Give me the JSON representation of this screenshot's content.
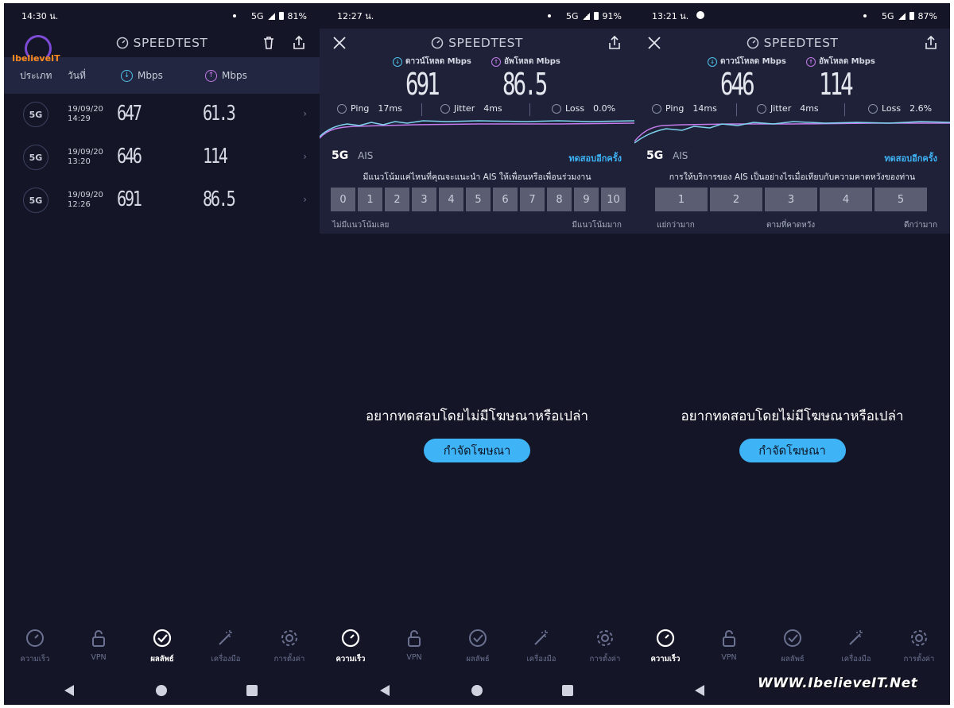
{
  "colors": {
    "bg": "#141526",
    "card": "#1e2138",
    "download": "#4fc3e8",
    "upload": "#c27be8",
    "accent": "#3eb3f5"
  },
  "brand_title": "SPEEDTEST",
  "panel1": {
    "status": {
      "time": "14:30 น.",
      "network": "5G",
      "battery": "81%"
    },
    "logo_text": "IbelieveIT",
    "header": {
      "type": "ประเภท",
      "date": "วันที่",
      "download_unit": "Mbps",
      "upload_unit": "Mbps"
    },
    "rows": [
      {
        "badge": "5G",
        "date": "19/09/20",
        "time": "14:29",
        "download": "647",
        "upload": "61.3"
      },
      {
        "badge": "5G",
        "date": "19/09/20",
        "time": "13:20",
        "download": "646",
        "upload": "114"
      },
      {
        "badge": "5G",
        "date": "19/09/20",
        "time": "12:26",
        "download": "691",
        "upload": "86.5"
      }
    ]
  },
  "panel2": {
    "status": {
      "time": "12:27 น.",
      "network": "5G",
      "battery": "91%"
    },
    "download_label": "ดาวน์โหลด Mbps",
    "upload_label": "อัพโหลด Mbps",
    "download": "691",
    "upload": "86.5",
    "ping_label": "Ping",
    "ping": "17ms",
    "jitter_label": "Jitter",
    "jitter": "4ms",
    "loss_label": "Loss",
    "loss": "0.0%",
    "net_type": "5G",
    "isp": "AIS",
    "retest": "ทดสอบอีกครั้ง",
    "question": "มีแนวโน้มแค่ไหนที่คุณจะแนะนำ AIS ให้เพื่อนหรือเพื่อนร่วมงาน",
    "scale": [
      "0",
      "1",
      "2",
      "3",
      "4",
      "5",
      "6",
      "7",
      "8",
      "9",
      "10"
    ],
    "scale_low": "ไม่มีแนวโน้มเลย",
    "scale_high": "มีแนวโน้มมาก",
    "ad_question": "อยากทดสอบโดยไม่มีโฆษณาหรือเปล่า",
    "ad_button": "กำจัดโฆษณา"
  },
  "panel3": {
    "status": {
      "time": "13:21 น.",
      "network": "5G",
      "battery": "87%"
    },
    "download_label": "ดาวน์โหลด Mbps",
    "upload_label": "อัพโหลด Mbps",
    "download": "646",
    "upload": "114",
    "ping_label": "Ping",
    "ping": "14ms",
    "jitter_label": "Jitter",
    "jitter": "4ms",
    "loss_label": "Loss",
    "loss": "2.6%",
    "net_type": "5G",
    "isp": "AIS",
    "retest": "ทดสอบอีกครั้ง",
    "question": "การให้บริการของ AIS เป็นอย่างไรเมื่อเทียบกับความคาดหวังของท่าน",
    "scale": [
      "1",
      "2",
      "3",
      "4",
      "5"
    ],
    "scale_low": "แย่กว่ามาก",
    "scale_mid": "ตามที่คาดหวัง",
    "scale_high": "ดีกว่ามาก",
    "ad_question": "อยากทดสอบโดยไม่มีโฆษณาหรือเปล่า",
    "ad_button": "กำจัดโฆษณา"
  },
  "nav": {
    "speed": "ความเร็ว",
    "vpn": "VPN",
    "results": "ผลลัพธ์",
    "tools": "เครื่องมือ",
    "settings": "การตั้งค่า"
  },
  "watermark": "WWW.IbelieveIT.Net"
}
